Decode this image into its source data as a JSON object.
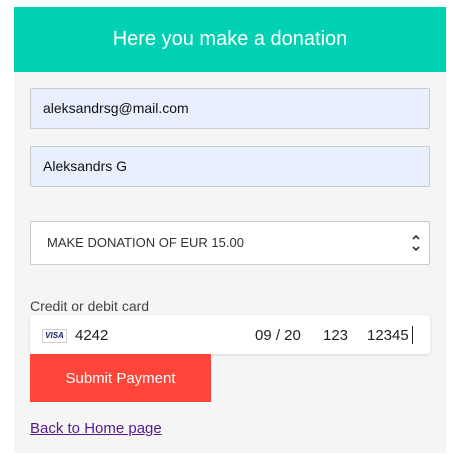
{
  "header": {
    "title": "Here you make a donation"
  },
  "form": {
    "email": "aleksandrsg@mail.com",
    "name": "Aleksandrs G",
    "donation_option": "MAKE DONATION OF EUR 15.00",
    "card_label": "Credit or debit card",
    "card": {
      "brand": "VISA",
      "number": "4242",
      "expiry": "09 / 20",
      "cvc": "123",
      "zip": "12345"
    },
    "submit_label": "Submit Payment"
  },
  "footer": {
    "back_link": "Back to Home page"
  },
  "colors": {
    "header": "#00d1b2",
    "submit": "#ff443a",
    "link": "#551a8b"
  }
}
